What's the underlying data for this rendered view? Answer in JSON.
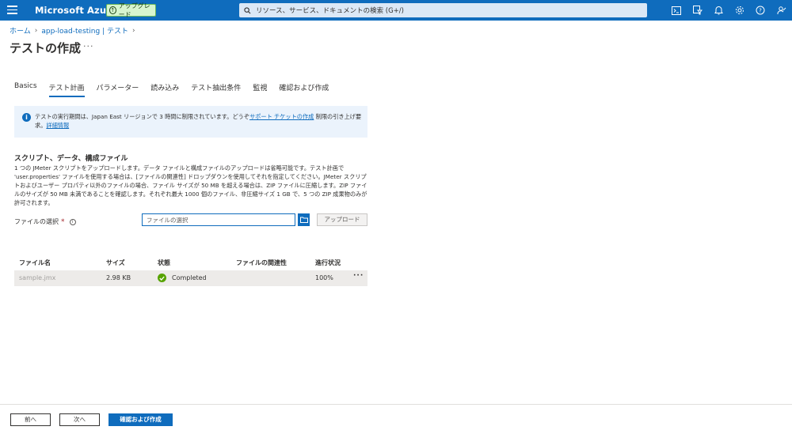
{
  "topbar": {
    "brand": "Microsoft Azure",
    "upgrade_label": "アップグレード",
    "search_placeholder": "リソース、サービス、ドキュメントの検索 (G+/)",
    "icons": [
      "cloud-shell-icon",
      "directory-filter-icon",
      "notifications-icon",
      "settings-icon",
      "help-icon",
      "feedback-icon"
    ]
  },
  "breadcrumb": {
    "items": [
      "ホーム",
      "app-load-testing | テスト"
    ]
  },
  "page": {
    "title": "テストの作成",
    "more": "···"
  },
  "tabs": [
    {
      "label": "Basics",
      "active": false
    },
    {
      "label": "テスト計画",
      "active": true
    },
    {
      "label": "パラメーター",
      "active": false
    },
    {
      "label": "読み込み",
      "active": false
    },
    {
      "label": "テスト抽出条件",
      "active": false
    },
    {
      "label": "監視",
      "active": false
    },
    {
      "label": "確認および作成",
      "active": false
    }
  ],
  "info": {
    "text_before": "テストの実行期間は、Japan East リージョンで 3 時間に制限されています。どうぞ",
    "link1": "サポート チケットの作成",
    "text_middle": " 制限の引き上げ要求。",
    "link2": "詳細情報"
  },
  "section": {
    "title": "スクリプト、データ、構成ファイル",
    "description": "1 つの JMeter スクリプトをアップロードします。データ ファイルと構成ファイルのアップロードは省略可能です。テスト計画で 'user.properties' ファイルを使用する場合は、[ファイルの関連性] ドロップダウンを使用してそれを指定してください。JMeter スクリプトおよびユーザー プロパティ以外のファイルの場合、ファイル サイズが 50 MB を超える場合は、ZIP ファイルに圧縮します。ZIP ファイルのサイズが 50 MB 未満であることを確認します。それぞれ最大 1000 個のファイル、非圧縮サイズ 1 GB で、5 つの ZIP 成果物のみが許可されます。",
    "file_label": "ファイルの選択",
    "required_mark": "*",
    "file_placeholder": "ファイルの選択",
    "upload_label": "アップロード"
  },
  "table": {
    "headers": [
      "ファイル名",
      "サイズ",
      "状態",
      "ファイルの関連性",
      "進行状況"
    ],
    "rows": [
      {
        "name": "sample.jmx",
        "size": "2.98 KB",
        "status": "Completed",
        "relevance": "",
        "progress": "100%"
      }
    ],
    "more": "···"
  },
  "footer": {
    "prev_label": "前へ",
    "next_label": "次へ",
    "review_label": "確認および作成"
  },
  "colors": {
    "accent": "#0f6cbd",
    "success": "#57a300",
    "upgrade_bg": "#d7f5cf"
  }
}
